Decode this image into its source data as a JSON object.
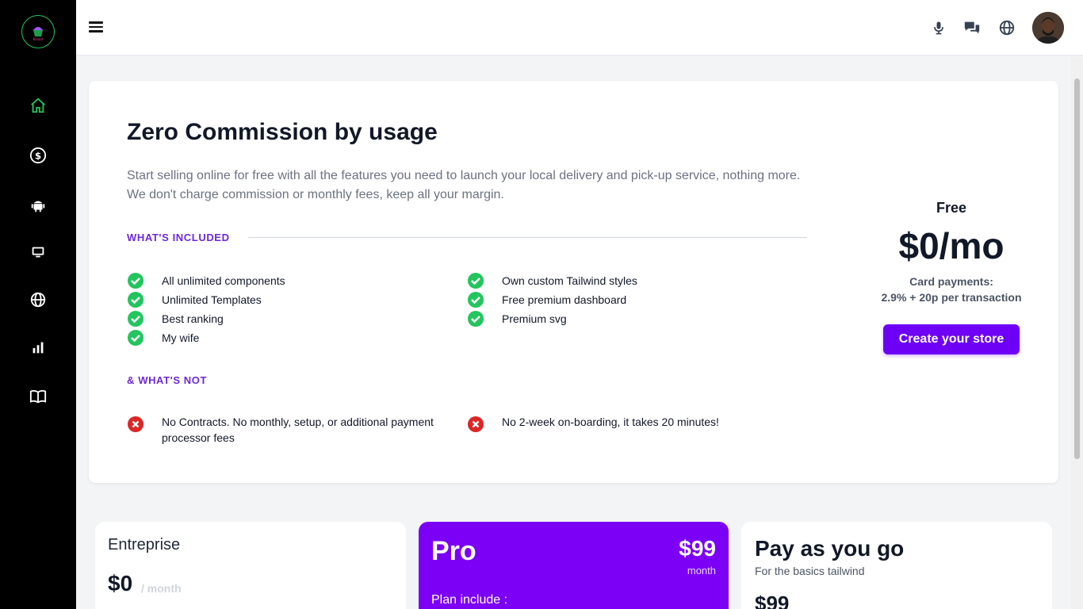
{
  "sidebar": {
    "logo_text": "Brand",
    "items": [
      {
        "name": "home",
        "active": true
      },
      {
        "name": "dollar"
      },
      {
        "name": "android"
      },
      {
        "name": "desktop"
      },
      {
        "name": "globe"
      },
      {
        "name": "chart"
      },
      {
        "name": "book"
      }
    ],
    "active_color": "#22c55e"
  },
  "header": {
    "icons": [
      "microphone-icon",
      "chat-icon",
      "globe-icon"
    ]
  },
  "pricing": {
    "title": "Zero Commission by usage",
    "description": "Start selling online for free with all the features you need to launch your local delivery and pick-up service, nothing more. We don't charge commission or monthly fees, keep all your margin.",
    "included_label": "WHAT'S INCLUDED",
    "included_left": [
      "All unlimited components",
      "Unlimited Templates",
      "Best ranking",
      "My wife"
    ],
    "included_right": [
      "Own custom Tailwind styles",
      "Free premium dashboard",
      "Premium svg"
    ],
    "not_label": "& WHAT'S NOT",
    "not_left": "No Contracts. No monthly, setup, or additional payment processor fees",
    "not_right": "No 2-week on-boarding, it takes 20 minutes!",
    "plan_name": "Free",
    "plan_price": "$0/mo",
    "plan_note_1": "Card payments:",
    "plan_note_2": "2.9% + 20p per transaction",
    "cta_label": "Create your store",
    "accent": "#6d00f5",
    "check_color": "#22c55e",
    "cross_color": "#dc2626"
  },
  "plans": {
    "enterprise": {
      "name": "Entreprise",
      "price": "$0",
      "period": "/ month"
    },
    "pro": {
      "name": "Pro",
      "price": "$99",
      "period": "month",
      "includes": "Plan include :"
    },
    "payg": {
      "name": "Pay as you go",
      "subtitle": "For the basics tailwind",
      "price": "$99"
    }
  }
}
